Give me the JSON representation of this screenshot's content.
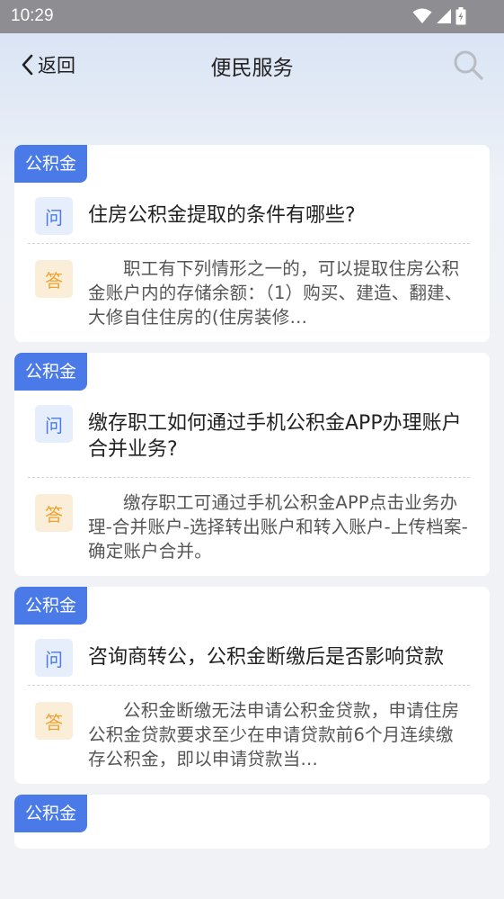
{
  "status_bar": {
    "time": "10:29"
  },
  "nav": {
    "back_label": "返回",
    "title": "便民服务"
  },
  "badges": {
    "question": "问",
    "answer": "答"
  },
  "items": [
    {
      "tag": "公积金",
      "question": "住房公积金提取的条件有哪些?",
      "answer": "职工有下列情形之一的，可以提取住房公积金账户内的存储余额：（1）购买、建造、翻建、大修自住住房的(住房装修…"
    },
    {
      "tag": "公积金",
      "question": "缴存职工如何通过手机公积金APP办理账户合并业务?",
      "answer": "缴存职工可通过手机公积金APP点击业务办理-合并账户-选择转出账户和转入账户-上传档案-确定账户合并。"
    },
    {
      "tag": "公积金",
      "question": "咨询商转公，公积金断缴后是否影响贷款",
      "answer": "公积金断缴无法申请公积金贷款，申请住房公积金贷款要求至少在申请贷款前6个月连续缴存公积金，即以申请贷款当…"
    },
    {
      "tag": "公积金",
      "question": "",
      "answer": ""
    }
  ]
}
